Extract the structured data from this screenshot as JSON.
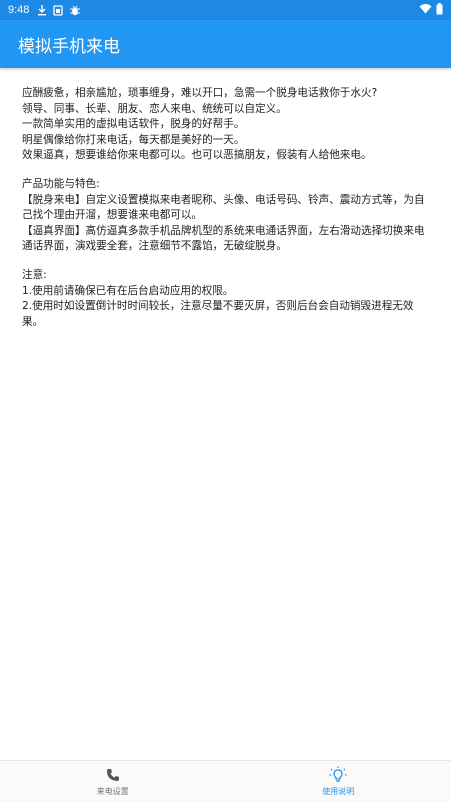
{
  "status_bar": {
    "time": "9:48",
    "icons": [
      "download-icon",
      "sim-icon",
      "bug-icon",
      "wifi-icon",
      "battery-icon"
    ]
  },
  "app_bar": {
    "title": "模拟手机来电"
  },
  "content": {
    "intro": [
      "应酬疲惫，相亲尴尬，琐事缠身，难以开口，急需一个脱身电话救你于水火?",
      "领导、同事、长辈、朋友、恋人来电、统统可以自定义。",
      "一款简单实用的虚拟电话软件，脱身的好帮手。",
      "明星偶像给你打来电话，每天都是美好的一天。",
      "效果逼真，想要谁给你来电都可以。也可以恶搞朋友，假装有人给他来电。"
    ],
    "features": [
      "产品功能与特色:",
      "【脱身来电】自定义设置模拟来电者昵称、头像、电话号码、铃声、震动方式等，为自己找个理由开溜，想要谁来电都可以。",
      "【逼真界面】高仿逼真多款手机品牌机型的系统来电通话界面，左右滑动选择切换来电通话界面，演戏要全套，注意细节不露馅，无破绽脱身。"
    ],
    "notes": [
      "注意:",
      "1.使用前请确保已有在后台启动应用的权限。",
      "2.使用时如设置倒计时时间较长，注意尽量不要灭屏，否则后台会自动销毁进程无效果。"
    ]
  },
  "bottom_nav": {
    "items": [
      {
        "label": "来电设置",
        "icon": "phone-icon",
        "active": false
      },
      {
        "label": "使用说明",
        "icon": "lightbulb-icon",
        "active": true
      }
    ]
  },
  "colors": {
    "status_bar": "#1e88e5",
    "app_bar": "#2196f3",
    "active_tab": "#2196f3"
  }
}
